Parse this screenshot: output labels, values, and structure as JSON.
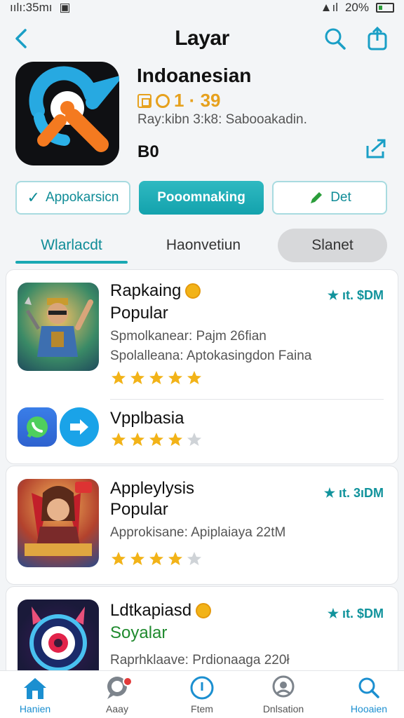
{
  "status_bar": {
    "time": "ıılı:35mı",
    "battery": "20%"
  },
  "header": {
    "title": "Layar"
  },
  "app": {
    "name": "Indoanesian",
    "rating": "1 · 39",
    "subinfo": "Ray:kibn 3:k8: Sabooakadin.",
    "price": "B0"
  },
  "actions": {
    "btn1": "Appokarsicn",
    "btn2": "Pooomnaking",
    "btn3": "Det"
  },
  "tabs": [
    "Wlarlacdt",
    "Haonvetiun",
    "Slanet"
  ],
  "cards": [
    {
      "title": "Rapkaing",
      "subtitle": "Popular",
      "line1": "Spmolkanear: Pajm 26fian",
      "line2": "Spolalleana: Aptokasingdon Faina",
      "metric": "★ ıt. $DM",
      "rating": 5,
      "stars_label": "★★★★★"
    },
    {
      "title": "Vpplbasia",
      "rating": 4,
      "stars_label": "★★★★☆"
    },
    {
      "title": "Appleylysis",
      "subtitle": "Popular",
      "line1": "Approkisane: Apiplaiaya 22tM",
      "metric": "★ ıt. 3ıDM",
      "rating": 4,
      "stars_label": "★★★★☆"
    },
    {
      "title": "Ldtkapiasd",
      "subtitle": "Soyalar",
      "line1": "Raprhklaave: Prdionaaga 220ł",
      "metric": "★ ıt. $DM"
    }
  ],
  "bottom_nav": [
    "Hanien",
    "Aaay",
    "Ftem",
    "Dnlsation",
    "Hooaien"
  ],
  "colors": {
    "accent": "#19a8b3",
    "star": "#f2b318",
    "nav_active": "#1b8fd0"
  }
}
